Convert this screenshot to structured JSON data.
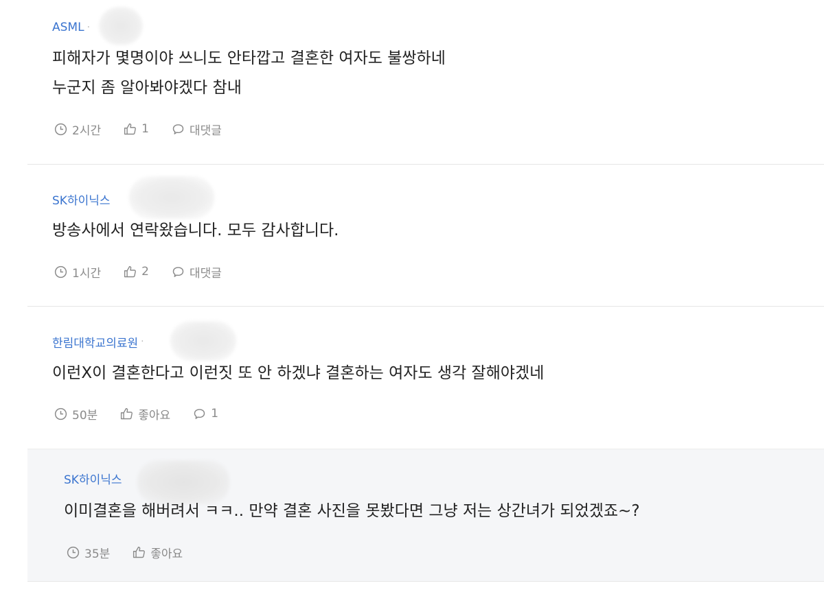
{
  "comments": [
    {
      "author": "ASML",
      "body": "피해자가 몇명이야 쓰니도 안타깝고 결혼한 여자도 불쌍하네\n누군지 좀 알아봐야겠다 참내",
      "time": "2시간",
      "likes": "1",
      "reply_label": "대댓글"
    },
    {
      "author": "SK하이닉스",
      "body": "방송사에서 연락왔습니다. 모두 감사합니다.",
      "time": "1시간",
      "likes": "2",
      "reply_label": "대댓글"
    },
    {
      "author": "한림대학교의료원",
      "body": "이런X이 결혼한다고 이런짓 또 안 하겠냐 결혼하는 여자도 생각 잘해야겠네",
      "time": "50분",
      "likes": "좋아요",
      "reply_label": "1"
    },
    {
      "author": "SK하이닉스",
      "body": "이미결혼을 해버려서 ㅋㅋ.. 만약 결혼 사진을 못봤다면 그냥 저는 상간녀가 되었겠죠~?",
      "time": "35분",
      "likes": "좋아요"
    }
  ],
  "colors": {
    "author": "#3a74cf",
    "meta": "#8a8a8a",
    "reply_background": "#f5f6f8"
  },
  "icons": {
    "time": "clock-icon",
    "like": "thumbs-up-icon",
    "reply": "speech-bubble-icon"
  }
}
